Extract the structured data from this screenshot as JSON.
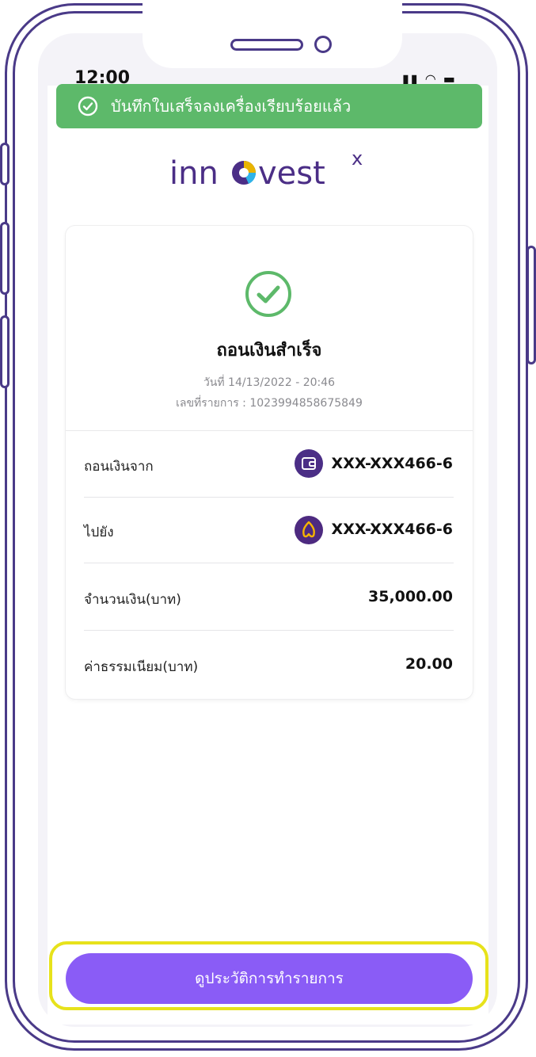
{
  "status_bar": {
    "time": "12:00"
  },
  "toast": {
    "message": "บันทึกใบเสร็จลงเครื่องเรียบร้อยแล้ว"
  },
  "brand": {
    "logo_text_prefix": "inn",
    "logo_text_suffix": "vest",
    "logo_superscript": "x"
  },
  "receipt": {
    "title": "ถอนเงินสำเร็จ",
    "date_line": "วันที่ 14/13/2022 - 20:46",
    "ref_line": "เลขที่รายการ : 1023994858675849",
    "rows": [
      {
        "label": "ถอนเงินจาก",
        "value": "XXX-XXX466-6",
        "icon": "wallet-icon"
      },
      {
        "label": "ไปยัง",
        "value": "XXX-XXX466-6",
        "icon": "bank-logo-icon"
      },
      {
        "label": "จำนวนเงิน(บาท)",
        "value": "35,000.00"
      },
      {
        "label": "ค่าธรรมเนียม(บาท)",
        "value": "20.00"
      }
    ]
  },
  "actions": {
    "history_button": "ดูประวัติการทำรายการ"
  },
  "colors": {
    "success": "#5db96a",
    "brand_purple": "#4b2e86",
    "button": "#8a5cf6",
    "highlight": "#e7e21b"
  }
}
